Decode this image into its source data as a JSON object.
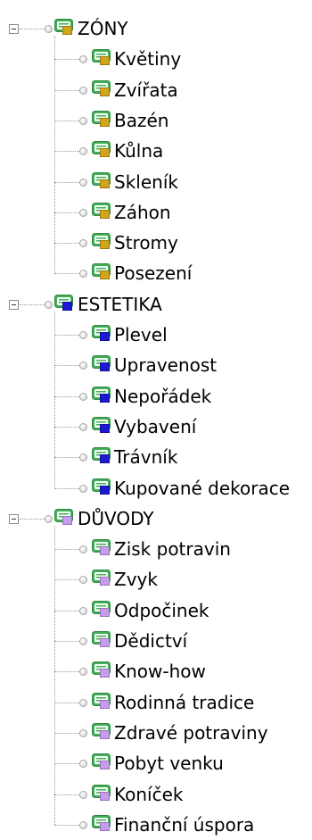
{
  "tree": {
    "groups": [
      {
        "label": "ZÓNY",
        "color": "#d2a51b",
        "children": [
          "Květiny",
          "Zvířata",
          "Bazén",
          "Kůlna",
          "Skleník",
          "Záhon",
          "Stromy",
          "Posezení"
        ]
      },
      {
        "label": "ESTETIKA",
        "color": "#1d18d2",
        "children": [
          "Plevel",
          "Upravenost",
          "Nepořádek",
          "Vybavení",
          "Trávník",
          "Kupované dekorace"
        ]
      },
      {
        "label": "DŮVODY",
        "color": "#c79cf0",
        "children": [
          "Zisk potravin",
          "Zvyk",
          "Odpočinek",
          "Dědictví",
          "Know-how",
          "Rodinná tradice",
          "Zdravé potraviny",
          "Pobyt venku",
          "Koníček",
          "Finanční úspora"
        ]
      }
    ],
    "node_icon": "text-document-icon",
    "node_icon_color": "#43ad57",
    "toggle_icon": "collapse-minus-icon"
  }
}
